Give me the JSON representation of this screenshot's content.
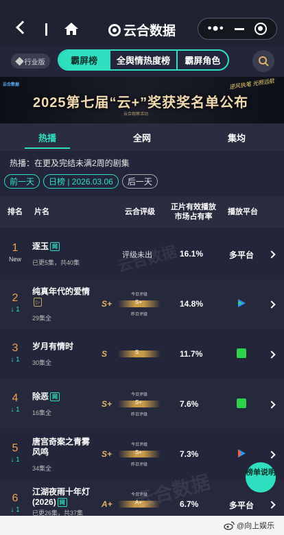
{
  "nav": {
    "brand": "云合数据"
  },
  "tabs": {
    "industry": "行业版",
    "items": [
      "霸屏榜",
      "全舆情热度榜",
      "霸屏角色"
    ]
  },
  "banner": {
    "logo": "云合数据",
    "title": "2025第七届“云+”奖获奖名单公布",
    "subtitle": "云合观察活动",
    "corner": "逆风执笔 光照远航"
  },
  "subtabs": [
    "热播",
    "全网",
    "集均"
  ],
  "note": "热播：在更及完结未满2周的剧集",
  "date": {
    "prev": "前一天",
    "current": "日榜 | 2026.03.06",
    "next": "后一天"
  },
  "table": {
    "headers": {
      "rank": "排名",
      "name": "片名",
      "grade": "云合评级",
      "share": "正片有效播放市场占有率",
      "platform": "播放平台"
    },
    "gauge_top": "今日评级",
    "gauge_bottom": "昨日评级",
    "rows": [
      {
        "rank": "1",
        "change": "New",
        "name": "逐玉",
        "tag": "网",
        "sub": "已更5集，共40集",
        "grade": "",
        "gauge": "",
        "pending": "评级未出",
        "share": "16.1%",
        "platform": "多平台"
      },
      {
        "rank": "2",
        "change": "↓ 1",
        "name": "纯真年代的爱情",
        "tag": "",
        "sub": "29集全",
        "grade": "S+",
        "gauge": "S+",
        "pending": "",
        "share": "14.8%",
        "platform": "tencent-video-icon"
      },
      {
        "rank": "3",
        "change": "↓ 1",
        "name": "岁月有情时",
        "tag": "",
        "sub": "30集全",
        "grade": "S",
        "gauge": "S",
        "pending": "",
        "share": "11.7%",
        "platform": "iqiyi-icon"
      },
      {
        "rank": "4",
        "change": "↓ 1",
        "name": "除恶",
        "tag": "网",
        "sub": "16集全",
        "grade": "S+",
        "gauge": "S+",
        "pending": "",
        "share": "7.6%",
        "platform": "iqiyi-icon"
      },
      {
        "rank": "5",
        "change": "↓ 1",
        "name": "唐宫奇案之青雾风鸣",
        "tag": "",
        "sub": "34集全",
        "grade": "S+",
        "gauge": "S+",
        "pending": "",
        "share": "7.3%",
        "platform": "youku-icon"
      },
      {
        "rank": "6",
        "change": "↓ 1",
        "name": "江湖夜雨十年灯(2026)",
        "tag": "网",
        "sub": "已更26集，共37集",
        "grade": "A+",
        "gauge": "A+",
        "pending": "",
        "share": "6.7%",
        "platform": "多平台"
      }
    ]
  },
  "float_btn": "榜单说明",
  "watermark": "云合数据",
  "footer": {
    "credit": "@向上娱乐"
  },
  "colors": {
    "accent": "#2fe0c0",
    "rank": "#f0a24f",
    "grade": "#e1b267"
  }
}
